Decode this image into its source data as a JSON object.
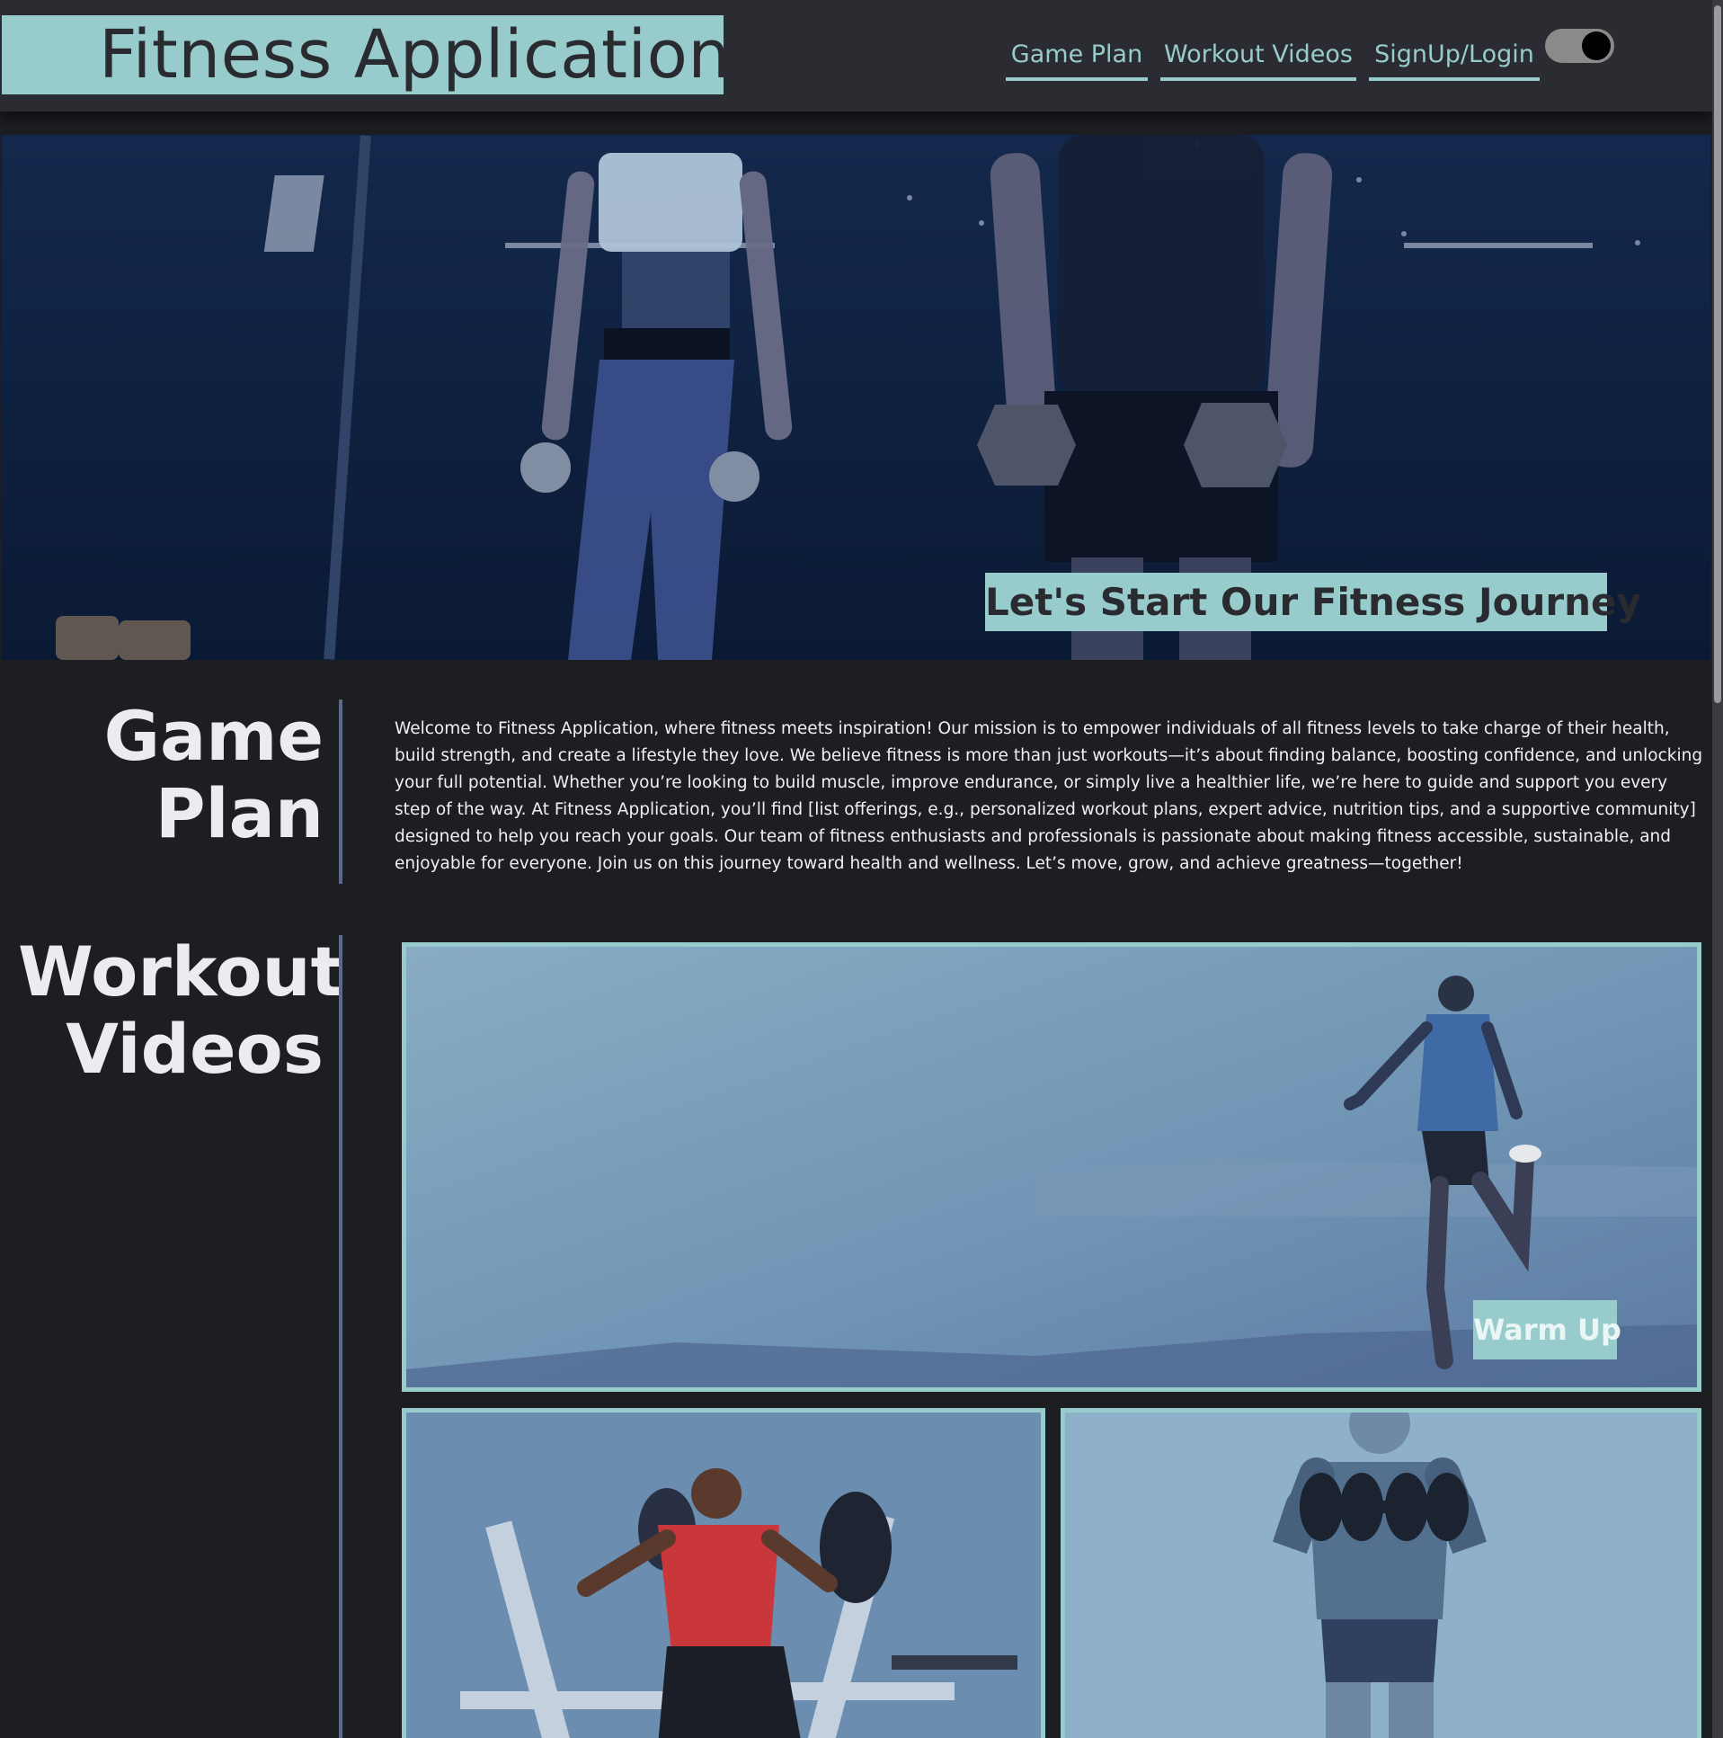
{
  "header": {
    "brand": "Fitness Application",
    "nav": [
      {
        "label": "Game Plan"
      },
      {
        "label": "Workout Videos"
      },
      {
        "label": "SignUp/Login"
      }
    ],
    "theme_toggle_on": true
  },
  "hero": {
    "cta": "Let's Start Our Fitness Journey"
  },
  "game_plan": {
    "title_line1": "Game",
    "title_line2": "Plan",
    "body": "Welcome to Fitness Application, where fitness meets inspiration! Our mission is to empower individuals of all fitness levels to take charge of their health, build strength, and create a lifestyle they love. We believe fitness is more than just workouts—it’s about finding balance, boosting confidence, and unlocking your full potential. Whether you’re looking to build muscle, improve endurance, or simply live a healthier life, we’re here to guide and support you every step of the way. At Fitness Application, you’ll find [list offerings, e.g., personalized workout plans, expert advice, nutrition tips, and a supportive community] designed to help you reach your goals. Our team of fitness enthusiasts and professionals is passionate about making fitness accessible, sustainable, and enjoyable for everyone. Join us on this journey toward health and wellness. Let’s move, grow, and achieve greatness—together!"
  },
  "workout_videos": {
    "title_line1": "Workout",
    "title_line2": "Videos",
    "cards": [
      {
        "label": "Warm Up"
      }
    ]
  },
  "colors": {
    "accent": "#98cbcb",
    "header_bg": "#2b2c32",
    "page_bg": "#1d1e22",
    "divider": "#5a6a8c"
  }
}
